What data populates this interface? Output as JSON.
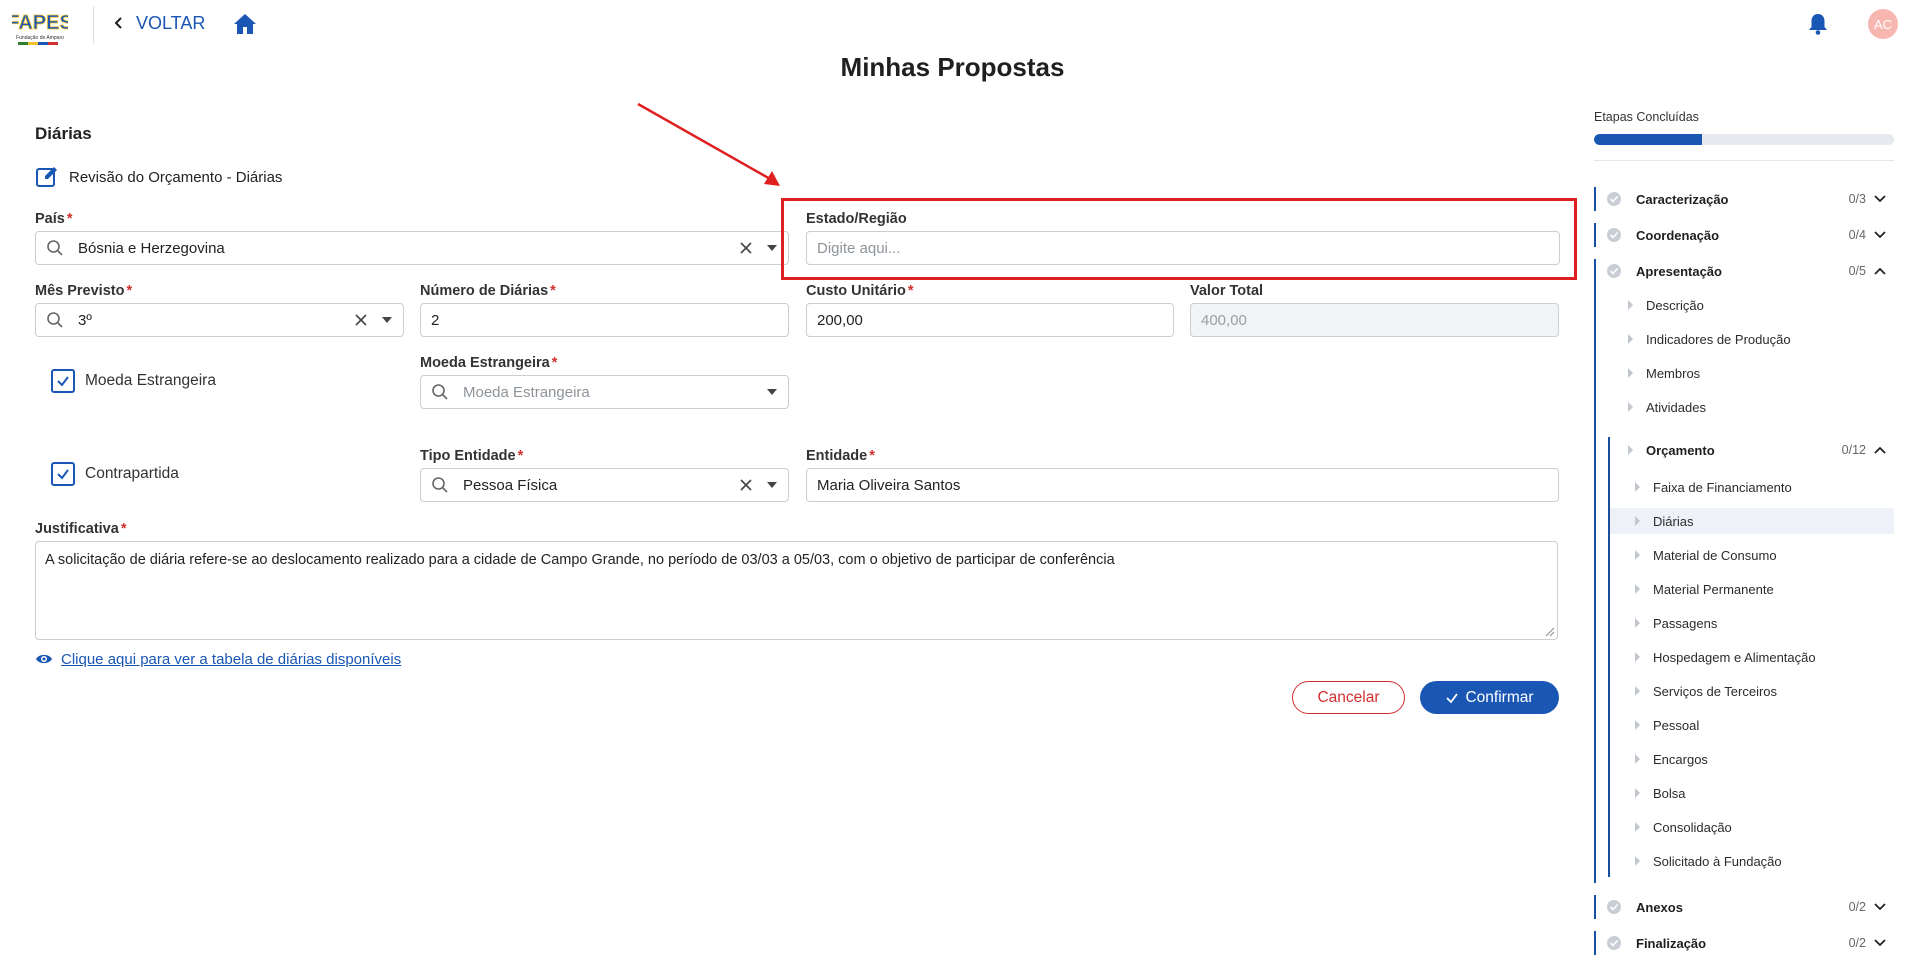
{
  "header": {
    "back_label": "VOLTAR",
    "avatar_initials": "AC",
    "logo_text": "FAPES",
    "logo_caption": "Fundação de Amparo"
  },
  "page_title": "Minhas Propostas",
  "section": {
    "title": "Diárias",
    "subtitle": "Revisão do Orçamento - Diárias"
  },
  "form": {
    "pais": {
      "label": "País",
      "value": "Bósnia e Herzegovina"
    },
    "estado": {
      "label": "Estado/Região",
      "placeholder": "Digite aqui..."
    },
    "mes": {
      "label": "Mês Previsto",
      "value": "3º"
    },
    "num_diarias": {
      "label": "Número de Diárias",
      "value": "2"
    },
    "custo": {
      "label": "Custo Unitário",
      "value": "200,00"
    },
    "valor_total": {
      "label": "Valor Total",
      "value": "400,00"
    },
    "moeda_check": {
      "label": "Moeda Estrangeira"
    },
    "moeda": {
      "label": "Moeda Estrangeira",
      "placeholder": "Moeda Estrangeira"
    },
    "contrapartida": {
      "label": "Contrapartida"
    },
    "tipo_entidade": {
      "label": "Tipo Entidade",
      "value": "Pessoa Física"
    },
    "entidade": {
      "label": "Entidade",
      "value": "Maria Oliveira Santos"
    },
    "justificativa": {
      "label": "Justificativa",
      "value": "A solicitação de diária refere-se ao deslocamento realizado para a cidade de Campo Grande, no período de 03/03 a 05/03, com o objetivo de participar de conferência"
    },
    "required_mark": "*"
  },
  "table_link": "Clique aqui para ver a tabela de diárias disponíveis",
  "actions": {
    "cancel": "Cancelar",
    "confirm": "Confirmar"
  },
  "sidebar": {
    "progress_label": "Etapas Concluídas",
    "progress_fraction": 0.36,
    "steps": [
      {
        "name": "Caracterização",
        "count": "0/3"
      },
      {
        "name": "Coordenação",
        "count": "0/4"
      },
      {
        "name": "Apresentação",
        "count": "0/5"
      },
      {
        "name": "Anexos",
        "count": "0/2"
      },
      {
        "name": "Finalização",
        "count": "0/2"
      }
    ],
    "apresentacao_items": [
      "Descrição",
      "Indicadores de Produção",
      "Membros",
      "Atividades"
    ],
    "orcamento": {
      "name": "Orçamento",
      "count": "0/12"
    },
    "orcamento_items": [
      "Faixa de Financiamento",
      "Diárias",
      "Material de Consumo",
      "Material Permanente",
      "Passagens",
      "Hospedagem e Alimentação",
      "Serviços de Terceiros",
      "Pessoal",
      "Encargos",
      "Bolsa",
      "Consolidação",
      "Solicitado à Fundação"
    ]
  },
  "colors": {
    "primary": "#1a56b4",
    "danger": "#d32f2f",
    "annotation": "#e02020"
  }
}
